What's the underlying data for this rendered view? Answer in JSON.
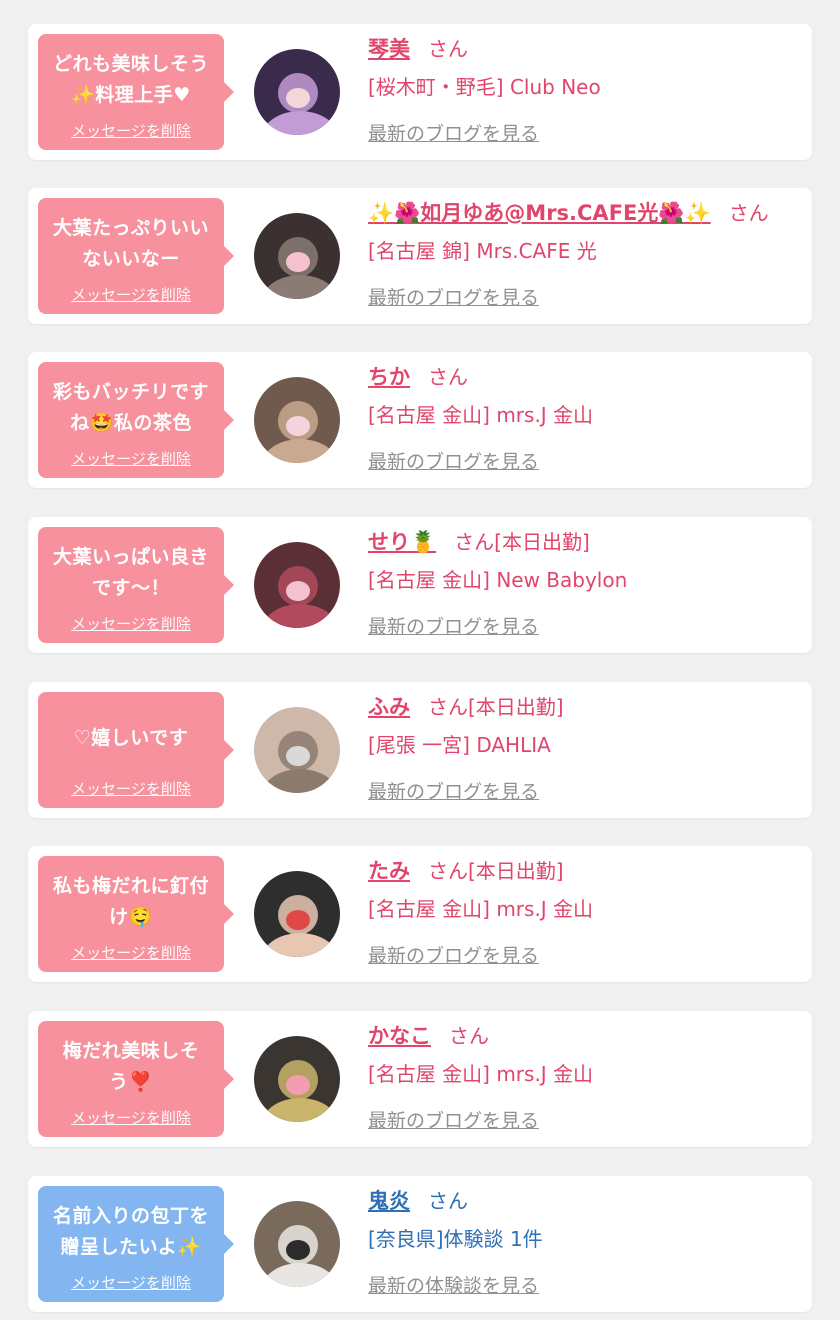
{
  "colors": {
    "page_bg": "#f0f0f0",
    "pink_bubble": "#f7919d",
    "blue_bubble": "#83b6f0",
    "pink_text": "#e2456b",
    "blue_text": "#2f6fb5",
    "gray_link": "#909090"
  },
  "delete_label": "メッセージを削除",
  "items": [
    {
      "theme": "pink",
      "message": "どれも美味しそう✨料理上手♥",
      "name": "琴美",
      "honorific": "さん",
      "shop": "[桜木町・野毛] Club Neo",
      "blog_link": "最新のブログを見る",
      "avatar_palette": [
        "#3a2a4c",
        "#c39bd6",
        "#f2d7d9"
      ]
    },
    {
      "theme": "pink",
      "message": "大葉たっぷりいいないいなー",
      "name": "✨🌺如月ゆあ@Mrs.CAFE光🌺✨",
      "honorific": "さん",
      "shop": "[名古屋 錦] Mrs.CAFE 光",
      "blog_link": "最新のブログを見る",
      "avatar_palette": [
        "#3b3131",
        "#8a7b74",
        "#f5c1cf"
      ]
    },
    {
      "theme": "pink",
      "message": "彩もバッチリですね🤩私の茶色",
      "name": "ちか",
      "honorific": "さん",
      "shop": "[名古屋 金山] mrs.J 金山",
      "blog_link": "最新のブログを見る",
      "avatar_palette": [
        "#6f5a4d",
        "#c9a98f",
        "#f4d3dd"
      ]
    },
    {
      "theme": "pink",
      "message": "大葉いっぱい良きです〜！",
      "name": "せり🍍",
      "honorific": "さん[本日出勤]",
      "shop": "[名古屋 金山] New Babylon",
      "blog_link": "最新のブログを見る",
      "avatar_palette": [
        "#5a3036",
        "#b04a5c",
        "#f3c2d0"
      ]
    },
    {
      "theme": "pink",
      "message": "♡嬉しいです",
      "name": "ふみ",
      "honorific": "さん[本日出勤]",
      "shop": "[尾張 一宮] DAHLIA",
      "blog_link": "最新のブログを見る",
      "avatar_palette": [
        "#cdb8a9",
        "#8b7a6e",
        "#d9d9d9"
      ]
    },
    {
      "theme": "pink",
      "message": "私も梅だれに釘付け🤤",
      "name": "たみ",
      "honorific": "さん[本日出勤]",
      "shop": "[名古屋 金山] mrs.J 金山",
      "blog_link": "最新のブログを見る",
      "avatar_palette": [
        "#2e2e2e",
        "#e7c6b2",
        "#e04848"
      ]
    },
    {
      "theme": "pink",
      "message": "梅だれ美味しそう❣️",
      "name": "かなこ",
      "honorific": "さん",
      "shop": "[名古屋 金山] mrs.J 金山",
      "blog_link": "最新のブログを見る",
      "avatar_palette": [
        "#3a3531",
        "#c8b46a",
        "#f29db2"
      ]
    },
    {
      "theme": "blue",
      "message": "名前入りの包丁を贈呈したいよ✨",
      "name": "鬼炎",
      "honorific": "さん",
      "shop": "[奈良県]体験談 1件",
      "blog_link": "最新の体験談を見る",
      "avatar_palette": [
        "#7a6a5c",
        "#e8e6e2",
        "#2b2b2b"
      ]
    }
  ]
}
